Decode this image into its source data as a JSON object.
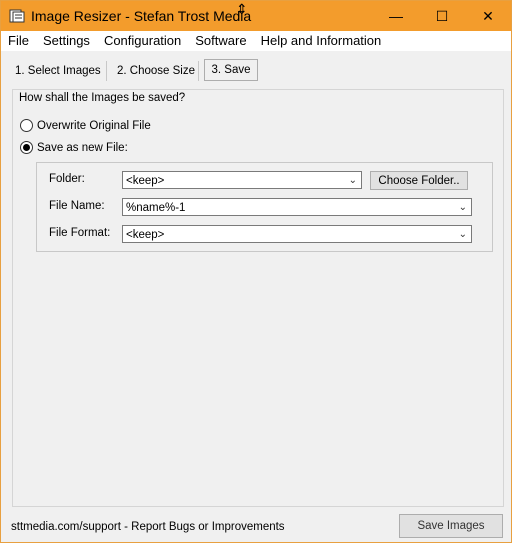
{
  "window": {
    "title": "Image Resizer - Stefan Trost Media",
    "controls": {
      "minimize": "—",
      "maximize": "☐",
      "close": "✕"
    }
  },
  "menu": [
    "File",
    "Settings",
    "Configuration",
    "Software",
    "Help and Information"
  ],
  "tabs": [
    {
      "label": "1. Select Images",
      "selected": false
    },
    {
      "label": "2. Choose Size",
      "selected": false
    },
    {
      "label": "3. Save",
      "selected": true
    }
  ],
  "save": {
    "group_label": "How shall the Images be saved?",
    "options": [
      {
        "label": "Overwrite Original File",
        "checked": false
      },
      {
        "label": "Save as new File:",
        "checked": true
      }
    ],
    "folder": {
      "label": "Folder:",
      "value": "<keep>",
      "button": "Choose Folder.."
    },
    "file_name": {
      "label": "File Name:",
      "value": "%name%-1"
    },
    "file_format": {
      "label": "File Format:",
      "value": "<keep>"
    }
  },
  "footer": {
    "link": "sttmedia.com/support - Report Bugs or Improvements",
    "save_button": "Save Images"
  },
  "colors": {
    "titlebar": "#f39c2c"
  }
}
